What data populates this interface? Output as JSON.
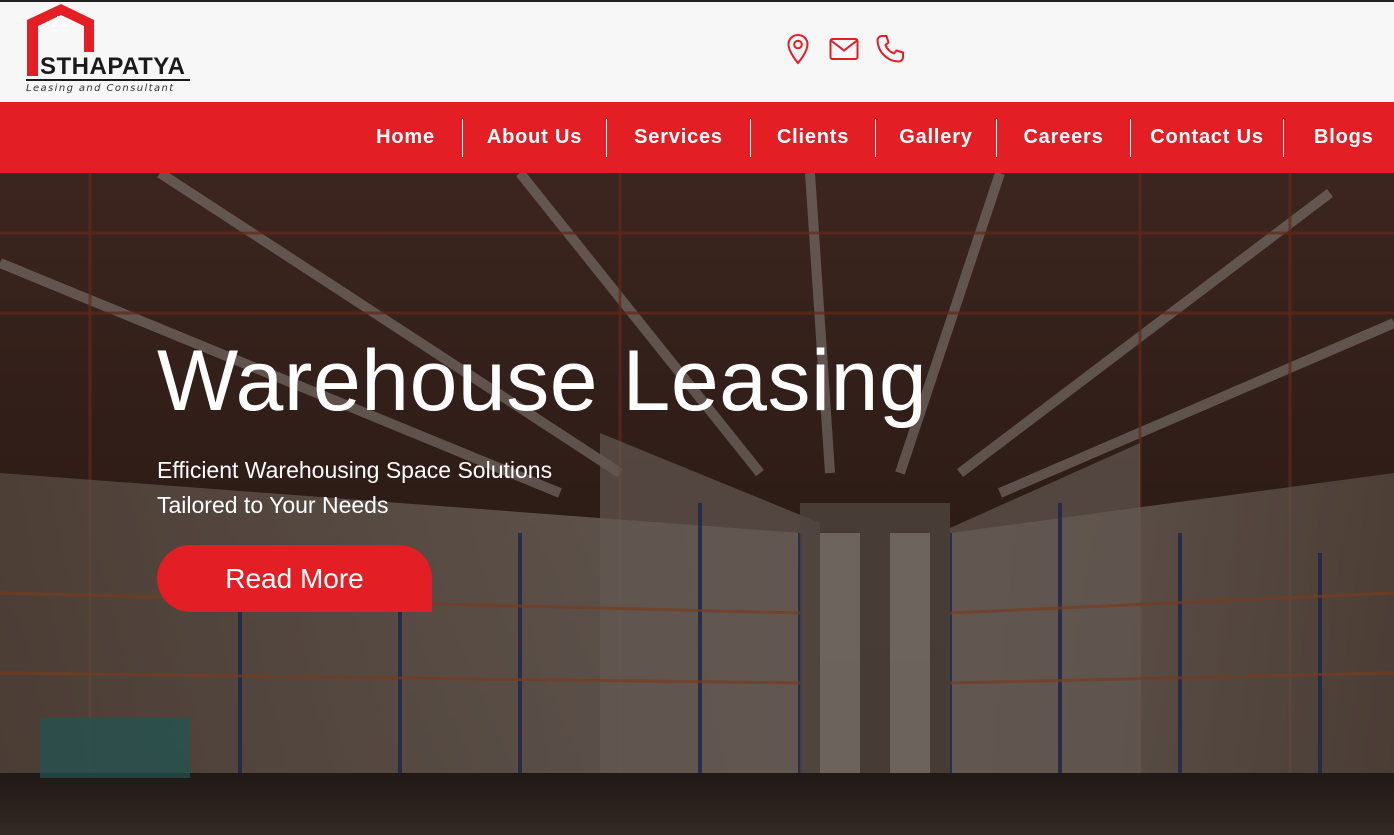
{
  "brand": {
    "name": "STHAPATYA",
    "tagline": "Leasing and Consultant",
    "accent_color": "#e31e24"
  },
  "header": {
    "contact_icons": [
      "location-pin-icon",
      "mail-icon",
      "phone-icon"
    ]
  },
  "nav": {
    "items": [
      {
        "label": "Home"
      },
      {
        "label": "About Us"
      },
      {
        "label": "Services"
      },
      {
        "label": "Clients"
      },
      {
        "label": "Gallery"
      },
      {
        "label": "Careers"
      },
      {
        "label": "Contact Us"
      },
      {
        "label": "Blogs"
      }
    ]
  },
  "hero": {
    "title": "Warehouse Leasing",
    "subtitle_line1": "Efficient Warehousing Space Solutions",
    "subtitle_line2": "Tailored to Your Needs",
    "cta_label": "Read More"
  }
}
